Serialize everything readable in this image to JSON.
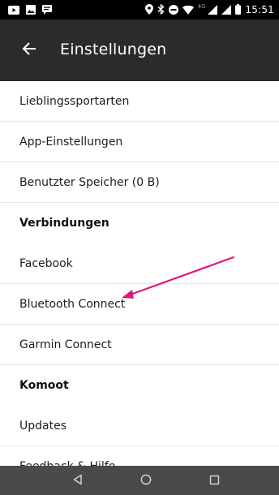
{
  "status_bar": {
    "time": "15:51",
    "network_label": "4G",
    "notification_icons": [
      "youtube-icon",
      "image-icon",
      "message-icon"
    ],
    "status_icons": [
      "location-icon",
      "bluetooth-icon",
      "do-not-disturb-icon",
      "wifi-icon",
      "signal-icon",
      "signal-icon",
      "battery-icon"
    ]
  },
  "app_bar": {
    "title": "Einstellungen",
    "back_icon": "arrow-back-icon"
  },
  "settings_list": {
    "items": [
      {
        "type": "item",
        "label": "Lieblingssportarten"
      },
      {
        "type": "item",
        "label": "App-Einstellungen"
      },
      {
        "type": "item",
        "label": "Benutzter Speicher (0 B)"
      },
      {
        "type": "header",
        "label": "Verbindungen"
      },
      {
        "type": "item",
        "label": "Facebook"
      },
      {
        "type": "item",
        "label": "Bluetooth Connect"
      },
      {
        "type": "item",
        "label": "Garmin Connect"
      },
      {
        "type": "header",
        "label": "Komoot"
      },
      {
        "type": "item",
        "label": "Updates"
      },
      {
        "type": "item",
        "label": "Feedback & Hilfe"
      }
    ]
  },
  "annotation": {
    "arrow_color": "#e0177a",
    "points_to": "Bluetooth Connect"
  },
  "nav_bar": {
    "buttons": [
      "back-triangle-icon",
      "home-circle-icon",
      "recents-square-icon"
    ]
  },
  "colors": {
    "app_bar": "#2b2b2b",
    "status_bar": "#000000",
    "nav_bar": "#4a4a4a",
    "divider": "#e6e6e6"
  }
}
